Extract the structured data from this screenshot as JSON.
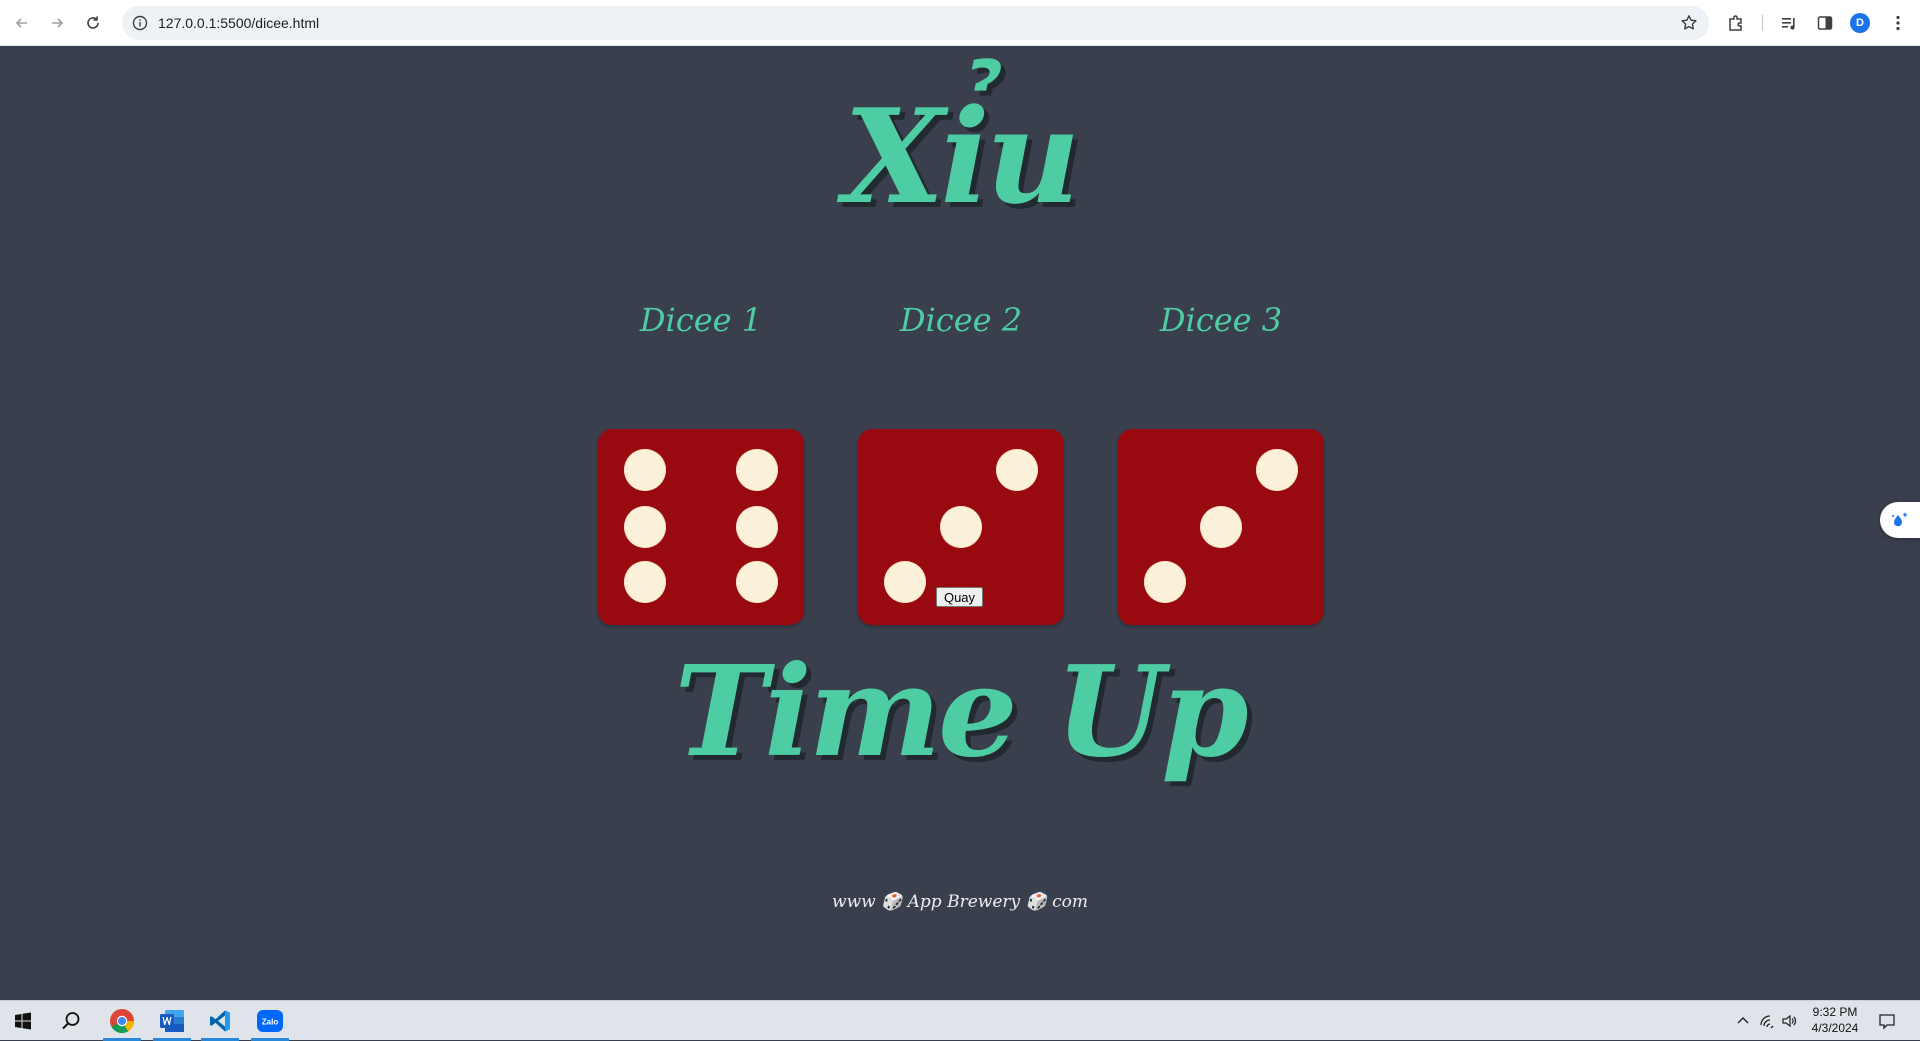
{
  "browser": {
    "url": "127.0.0.1:5500/dicee.html",
    "profile_initial": "D"
  },
  "page": {
    "title": "Xỉu",
    "dice": [
      {
        "label": "Dicee 1",
        "value": 6
      },
      {
        "label": "Dicee 2",
        "value": 3
      },
      {
        "label": "Dicee 3",
        "value": 3
      }
    ],
    "roll_button": "Quay",
    "result": "Time Up",
    "footer": "www 🎲 App Brewery 🎲 com"
  },
  "taskbar": {
    "apps": [
      "chrome-icon",
      "word-icon",
      "vscode-icon",
      "zalo-icon"
    ],
    "zalo_label": "Zalo",
    "time": "9:32 PM",
    "date": "4/3/2024"
  },
  "colors": {
    "background": "#393f4d",
    "accent": "#4ecca3",
    "die": "#990a10",
    "pip": "#fbf0d9"
  }
}
